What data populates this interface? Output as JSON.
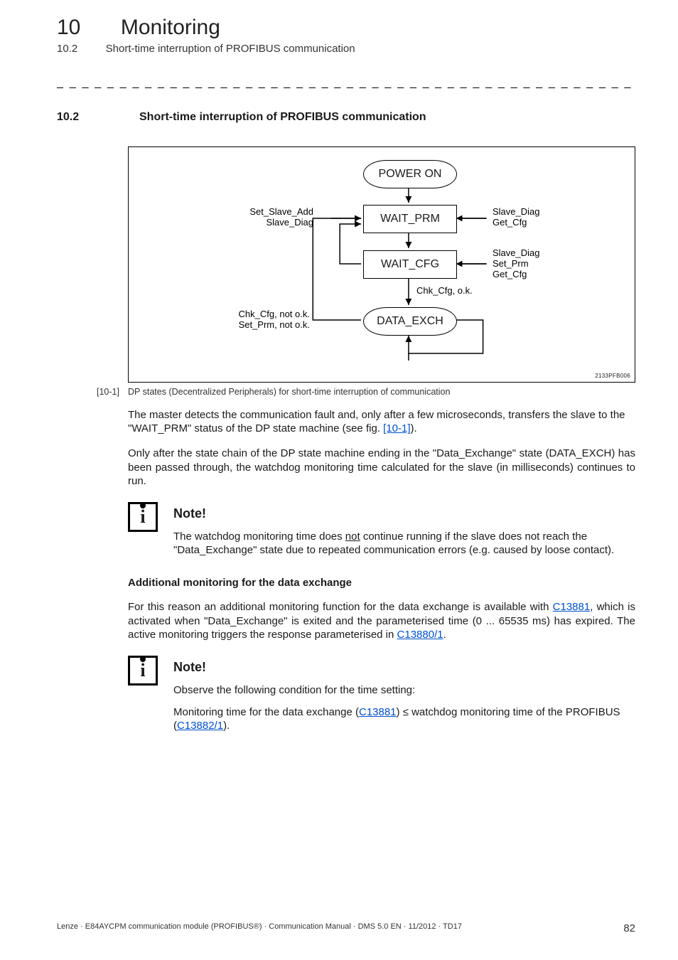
{
  "header": {
    "chapter_num": "10",
    "chapter_title": "Monitoring",
    "section_num": "10.2",
    "section_title": "Short-time interruption of PROFIBUS communication"
  },
  "section_heading": {
    "num": "10.2",
    "title": "Short-time interruption of PROFIBUS communication"
  },
  "diagram": {
    "states": {
      "power_on": "POWER ON",
      "wait_prm": "WAIT_PRM",
      "wait_cfg": "WAIT_CFG",
      "data_exch": "DATA_EXCH"
    },
    "labels": {
      "left_wait_prm": "Set_Slave_Add\nSlave_Diag",
      "right_wait_prm": "Slave_Diag\nGet_Cfg",
      "right_wait_cfg": "Slave_Diag\nSet_Prm\nGet_Cfg",
      "chk_ok": "Chk_Cfg, o.k.",
      "left_data_exch": "Chk_Cfg, not o.k.\nSet_Prm, not o.k."
    },
    "code": "2133PFB006"
  },
  "caption": {
    "num": "[10-1]",
    "text": "DP states (Decentralized Peripherals) for short-time interruption of communication"
  },
  "para1_a": "The master detects the communication fault and, only after a few microseconds, transfers the slave to the \"WAIT_PRM\" status of the DP state machine (see fig. ",
  "para1_link": "[10-1]",
  "para1_b": ").",
  "para2": "Only after the state chain of the DP state machine ending in the \"Data_Exchange\" state (DATA_EXCH) has been passed through, the watchdog monitoring time calculated for the slave (in milliseconds) continues to run.",
  "note1": {
    "title": "Note!",
    "text_a": "The watchdog monitoring time does ",
    "text_u": "not",
    "text_b": " continue running if the slave does not reach the \"Data_Exchange\" state due to repeated communication errors (e.g. caused by loose contact)."
  },
  "sub_heading": "Additional monitoring for the data exchange",
  "para3_a": "For this reason an additional monitoring function for the data exchange is available with ",
  "para3_link1": "C13881",
  "para3_b": ", which is activated when \"Data_Exchange\" is exited and the parameterised time (0 ... 65535 ms) has expired. The active monitoring triggers the response parameterised in ",
  "para3_link2": "C13880/1",
  "para3_c": ".",
  "note2": {
    "title": "Note!",
    "line1": "Observe the following condition for the time setting:",
    "line2_a": "Monitoring time for the data exchange (",
    "line2_link1": "C13881",
    "line2_b": ") ≤ watchdog monitoring time of the PROFIBUS (",
    "line2_link2": "C13882/1",
    "line2_c": ")."
  },
  "footer": {
    "text": "Lenze · E84AYCPM communication module (PROFIBUS®) · Communication Manual · DMS 5.0 EN · 11/2012 · TD17",
    "page": "82"
  }
}
